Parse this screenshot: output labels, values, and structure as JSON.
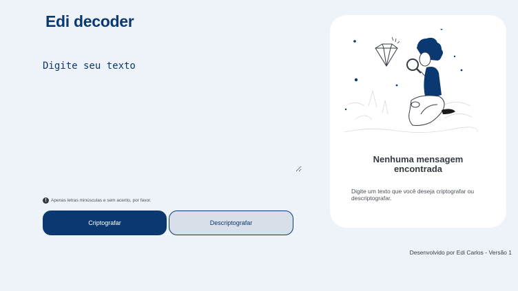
{
  "header": {
    "title": "Edi decoder"
  },
  "input": {
    "placeholder": "Digite seu texto"
  },
  "hint": {
    "icon": "exclamation-circle-icon",
    "text": "Apenas letras minúsculas e sem acento, por favor."
  },
  "buttons": {
    "encrypt": "Criptografar",
    "decrypt": "Descriptografar"
  },
  "output_panel": {
    "illustration": "boy-with-magnifying-glass-and-diamond",
    "title_line1": "Nenhuma mensagem",
    "title_line2": "encontrada",
    "description": "Digite um texto que você deseja criptografar ou descriptografar."
  },
  "footer": {
    "text": "Desenvolvido por Edi Carlos - Versão 1"
  },
  "colors": {
    "primary": "#0a3871",
    "background": "#eef2f9",
    "secondary": "#d8dfe8",
    "panel": "#ffffff"
  }
}
